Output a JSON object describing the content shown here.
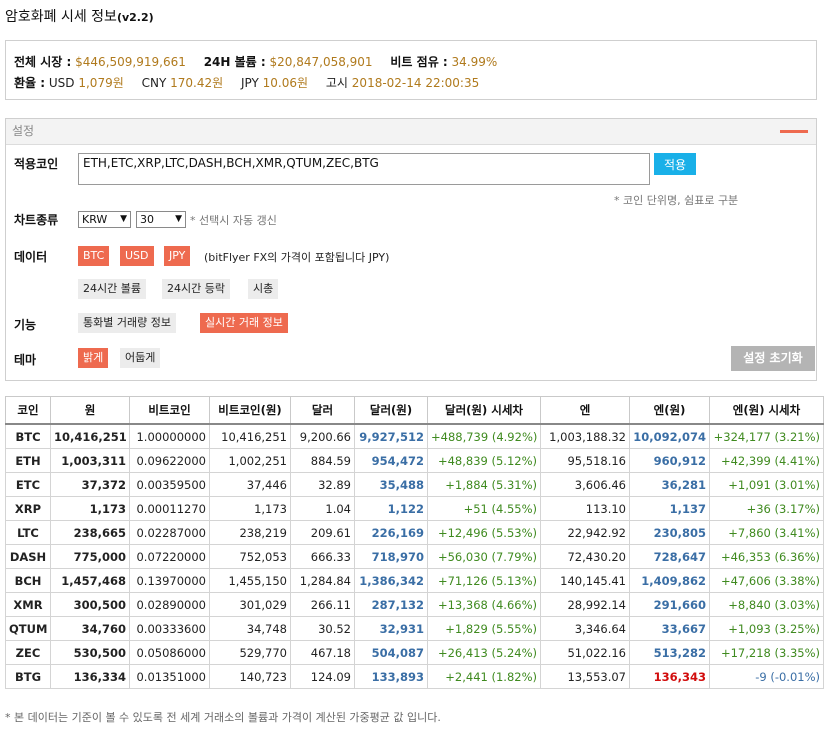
{
  "title": "암호화폐 시세 정보",
  "version": "(v2.2)",
  "summary": {
    "total_market_label": "전체 시장 :",
    "total_market": "$446,509,919,661",
    "volume_label": "24H 볼륨 :",
    "volume": "$20,847,058,901",
    "btc_share_label": "비트 점유 :",
    "btc_share": "34.99%",
    "fx_label": "환율 :",
    "usd_label": "USD",
    "usd": "1,079원",
    "cny_label": "CNY",
    "cny": "170.42원",
    "jpy_label": "JPY",
    "jpy": "10.06원",
    "notice_label": "고시",
    "notice": "2018-02-14 22:00:35"
  },
  "settings": {
    "header": "설정",
    "coins_label": "적용코인",
    "coins_value": "ETH,ETC,XRP,LTC,DASH,BCH,XMR,QTUM,ZEC,BTG",
    "apply": "적용",
    "coins_hint": "* 코인 단위명, 쉼표로 구분",
    "chart_label": "차트종류",
    "chart_currency": "KRW",
    "chart_period": "30",
    "chart_hint": "* 선택시 자동 갱신",
    "data_label": "데이터",
    "data_btc": "BTC",
    "data_usd": "USD",
    "data_jpy": "JPY",
    "data_note": "(bitFlyer FX의 가격이 포함됩니다 JPY)",
    "opt_volume": "24시간 볼륨",
    "opt_change": "24시간 등락",
    "opt_cap": "시총",
    "feature_label": "기능",
    "feat_volume": "통화별 거래량 정보",
    "feat_realtime": "실시간 거래 정보",
    "theme_label": "테마",
    "theme_light": "밝게",
    "theme_dark": "어둡게",
    "reset": "설정 초기화"
  },
  "table": {
    "headers": [
      "코인",
      "원",
      "비트코인",
      "비트코인(원)",
      "달러",
      "달러(원)",
      "달러(원) 시세차",
      "엔",
      "엔(원)",
      "엔(원) 시세차"
    ],
    "rows": [
      {
        "coin": "BTC",
        "krw": "10,416,251",
        "btc": "1.00000000",
        "btc_krw": "10,416,251",
        "usd": "9,200.66",
        "usd_krw": "9,927,512",
        "usd_diff": "+488,739 (4.92%)",
        "jpy": "1,003,188.32",
        "jpy_krw": "10,092,074",
        "jpy_diff": "+324,177 (3.21%)"
      },
      {
        "coin": "ETH",
        "krw": "1,003,311",
        "btc": "0.09622000",
        "btc_krw": "1,002,251",
        "usd": "884.59",
        "usd_krw": "954,472",
        "usd_diff": "+48,839 (5.12%)",
        "jpy": "95,518.16",
        "jpy_krw": "960,912",
        "jpy_diff": "+42,399 (4.41%)"
      },
      {
        "coin": "ETC",
        "krw": "37,372",
        "btc": "0.00359500",
        "btc_krw": "37,446",
        "usd": "32.89",
        "usd_krw": "35,488",
        "usd_diff": "+1,884 (5.31%)",
        "jpy": "3,606.46",
        "jpy_krw": "36,281",
        "jpy_diff": "+1,091 (3.01%)"
      },
      {
        "coin": "XRP",
        "krw": "1,173",
        "btc": "0.00011270",
        "btc_krw": "1,173",
        "usd": "1.04",
        "usd_krw": "1,122",
        "usd_diff": "+51 (4.55%)",
        "jpy": "113.10",
        "jpy_krw": "1,137",
        "jpy_diff": "+36 (3.17%)"
      },
      {
        "coin": "LTC",
        "krw": "238,665",
        "btc": "0.02287000",
        "btc_krw": "238,219",
        "usd": "209.61",
        "usd_krw": "226,169",
        "usd_diff": "+12,496 (5.53%)",
        "jpy": "22,942.92",
        "jpy_krw": "230,805",
        "jpy_diff": "+7,860 (3.41%)"
      },
      {
        "coin": "DASH",
        "krw": "775,000",
        "btc": "0.07220000",
        "btc_krw": "752,053",
        "usd": "666.33",
        "usd_krw": "718,970",
        "usd_diff": "+56,030 (7.79%)",
        "jpy": "72,430.20",
        "jpy_krw": "728,647",
        "jpy_diff": "+46,353 (6.36%)"
      },
      {
        "coin": "BCH",
        "krw": "1,457,468",
        "btc": "0.13970000",
        "btc_krw": "1,455,150",
        "usd": "1,284.84",
        "usd_krw": "1,386,342",
        "usd_diff": "+71,126 (5.13%)",
        "jpy": "140,145.41",
        "jpy_krw": "1,409,862",
        "jpy_diff": "+47,606 (3.38%)"
      },
      {
        "coin": "XMR",
        "krw": "300,500",
        "btc": "0.02890000",
        "btc_krw": "301,029",
        "usd": "266.11",
        "usd_krw": "287,132",
        "usd_diff": "+13,368 (4.66%)",
        "jpy": "28,992.14",
        "jpy_krw": "291,660",
        "jpy_diff": "+8,840 (3.03%)"
      },
      {
        "coin": "QTUM",
        "krw": "34,760",
        "btc": "0.00333600",
        "btc_krw": "34,748",
        "usd": "30.52",
        "usd_krw": "32,931",
        "usd_diff": "+1,829 (5.55%)",
        "jpy": "3,346.64",
        "jpy_krw": "33,667",
        "jpy_diff": "+1,093 (3.25%)"
      },
      {
        "coin": "ZEC",
        "krw": "530,500",
        "btc": "0.05086000",
        "btc_krw": "529,770",
        "usd": "467.18",
        "usd_krw": "504,087",
        "usd_diff": "+26,413 (5.24%)",
        "jpy": "51,022.16",
        "jpy_krw": "513,282",
        "jpy_diff": "+17,218 (3.35%)"
      },
      {
        "coin": "BTG",
        "krw": "136,334",
        "btc": "0.01351000",
        "btc_krw": "140,723",
        "usd": "124.09",
        "usd_krw": "133,893",
        "usd_diff": "+2,441 (1.82%)",
        "jpy": "13,553.07",
        "jpy_krw": "136,343",
        "jpy_diff": "-9 (-0.01%)",
        "jpy_highlight": true
      }
    ]
  },
  "footer": "* 본 데이터는 기준이 볼 수 있도록 전 세계 거래소의 볼륨과 가격이 계산된 가중평균 값 입니다."
}
